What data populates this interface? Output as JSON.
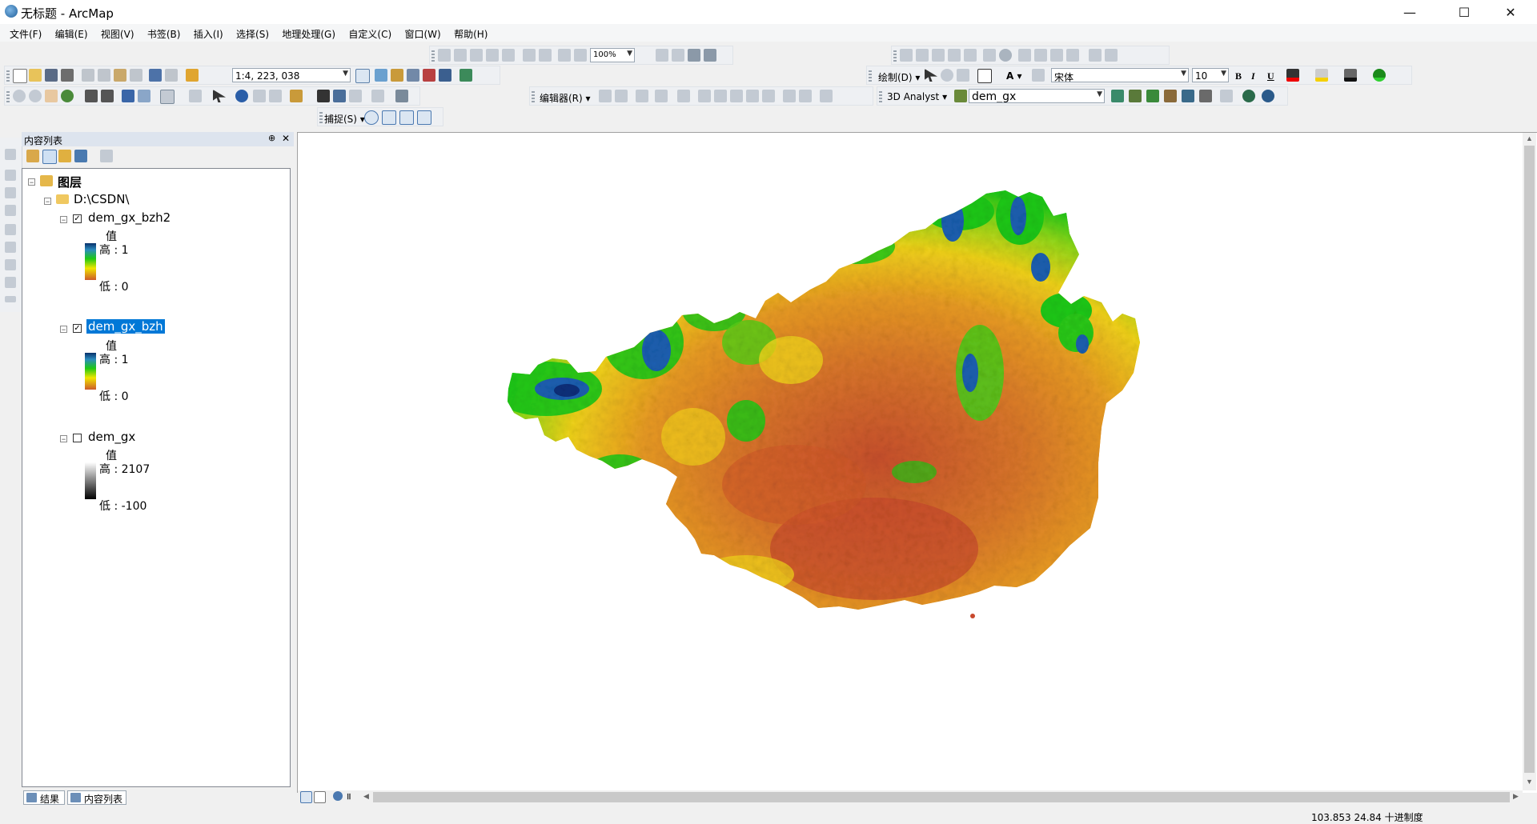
{
  "window": {
    "title": "无标题 - ArcMap",
    "minimize": "—",
    "maximize": "☐",
    "close": "✕"
  },
  "menu": [
    "文件(F)",
    "编辑(E)",
    "视图(V)",
    "书签(B)",
    "插入(I)",
    "选择(S)",
    "地理处理(G)",
    "自定义(C)",
    "窗口(W)",
    "帮助(H)"
  ],
  "toolbars": {
    "zoom_combo": "100%",
    "scale_combo": "1:4, 223, 038",
    "draw_label": "绘制(D)",
    "font_combo": "宋体",
    "font_size_combo": "10",
    "bold": "B",
    "italic": "I",
    "underline": "U",
    "editor_label": "编辑器(R)",
    "analyst_label": "3D Analyst",
    "layer_combo": "dem_gx",
    "snapping_label": "捕捉(S)"
  },
  "toc": {
    "title": "内容列表",
    "pin": "⊕",
    "close": "✕",
    "root_label": "图层",
    "folder_label": "D:\\CSDN\\",
    "layers": [
      {
        "name": "dem_gx_bzh2",
        "checked": true,
        "selected": false,
        "value_header": "值",
        "high": "高 : 1",
        "low": "低 : 0",
        "ramp": "color"
      },
      {
        "name": "dem_gx_bzh",
        "checked": true,
        "selected": true,
        "value_header": "值",
        "high": "高 : 1",
        "low": "低 : 0",
        "ramp": "color"
      },
      {
        "name": "dem_gx",
        "checked": false,
        "selected": false,
        "value_header": "值",
        "high": "高 : 2107",
        "low": "低 : -100",
        "ramp": "gray"
      }
    ],
    "tabs": [
      "结果",
      "内容列表"
    ]
  },
  "status": {
    "coords": "103.853  24.84 十进制度"
  },
  "colors": {
    "ramp_high": "#08306b",
    "ramp_mid_green": "#1ec814",
    "ramp_mid_yellow": "#f0e600",
    "ramp_low": "#cd5a2a",
    "selected_bg": "#0078d7"
  }
}
